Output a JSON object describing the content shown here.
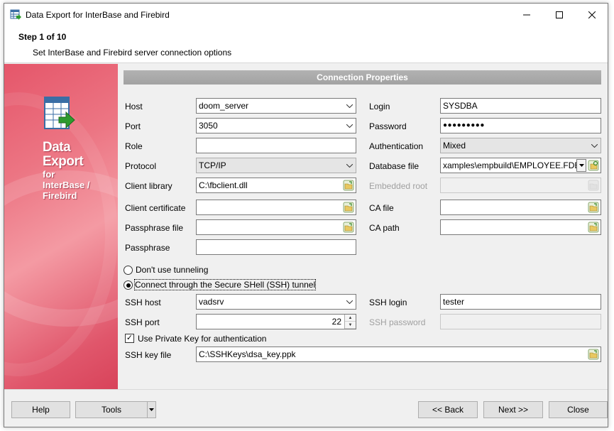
{
  "window": {
    "title": "Data Export for InterBase and Firebird"
  },
  "header": {
    "step": "Step 1 of 10",
    "subtitle": "Set InterBase and Firebird server connection options"
  },
  "sidebar": {
    "title_line1": "Data",
    "title_line2": "Export",
    "sub_line1": "for",
    "sub_line2": "InterBase /",
    "sub_line3": "Firebird"
  },
  "section": {
    "title": "Connection Properties"
  },
  "left_fields": {
    "host": {
      "label": "Host",
      "value": "doom_server"
    },
    "port": {
      "label": "Port",
      "value": "3050"
    },
    "role": {
      "label": "Role",
      "value": ""
    },
    "protocol": {
      "label": "Protocol",
      "value": "TCP/IP"
    },
    "client_library": {
      "label": "Client library",
      "value": "C:\\fbclient.dll"
    },
    "client_certificate": {
      "label": "Client certificate",
      "value": ""
    },
    "passphrase_file": {
      "label": "Passphrase file",
      "value": ""
    },
    "passphrase": {
      "label": "Passphrase",
      "value": ""
    }
  },
  "right_fields": {
    "login": {
      "label": "Login",
      "value": "SYSDBA"
    },
    "password": {
      "label": "Password",
      "value": "●●●●●●●●●"
    },
    "authentication": {
      "label": "Authentication",
      "value": "Mixed"
    },
    "database_file": {
      "label": "Database file",
      "value": "xamples\\empbuild\\EMPLOYEE.FDB"
    },
    "embedded_root": {
      "label": "Embedded root",
      "value": ""
    },
    "ca_file": {
      "label": "CA file",
      "value": ""
    },
    "ca_path": {
      "label": "CA path",
      "value": ""
    }
  },
  "tunneling": {
    "no_tunnel_label": "Don't use tunneling",
    "ssh_label": "Connect through the Secure SHell (SSH) tunnel",
    "selected": "ssh"
  },
  "ssh": {
    "host": {
      "label": "SSH host",
      "value": "vadsrv"
    },
    "port": {
      "label": "SSH port",
      "value": "22"
    },
    "login": {
      "label": "SSH login",
      "value": "tester"
    },
    "password": {
      "label": "SSH password",
      "value": ""
    },
    "use_private_key": {
      "label": "Use Private Key for authentication",
      "checked": true
    },
    "key_file": {
      "label": "SSH key file",
      "value": "C:\\SSHKeys\\dsa_key.ppk"
    }
  },
  "footer": {
    "help": "Help",
    "tools": "Tools",
    "back": "<< Back",
    "next": "Next >>",
    "close": "Close"
  },
  "colors": {
    "sidebar_accent": "#e5566a",
    "section_bar": "#a8a8a8",
    "browse_icon": "#4a9a2a"
  }
}
